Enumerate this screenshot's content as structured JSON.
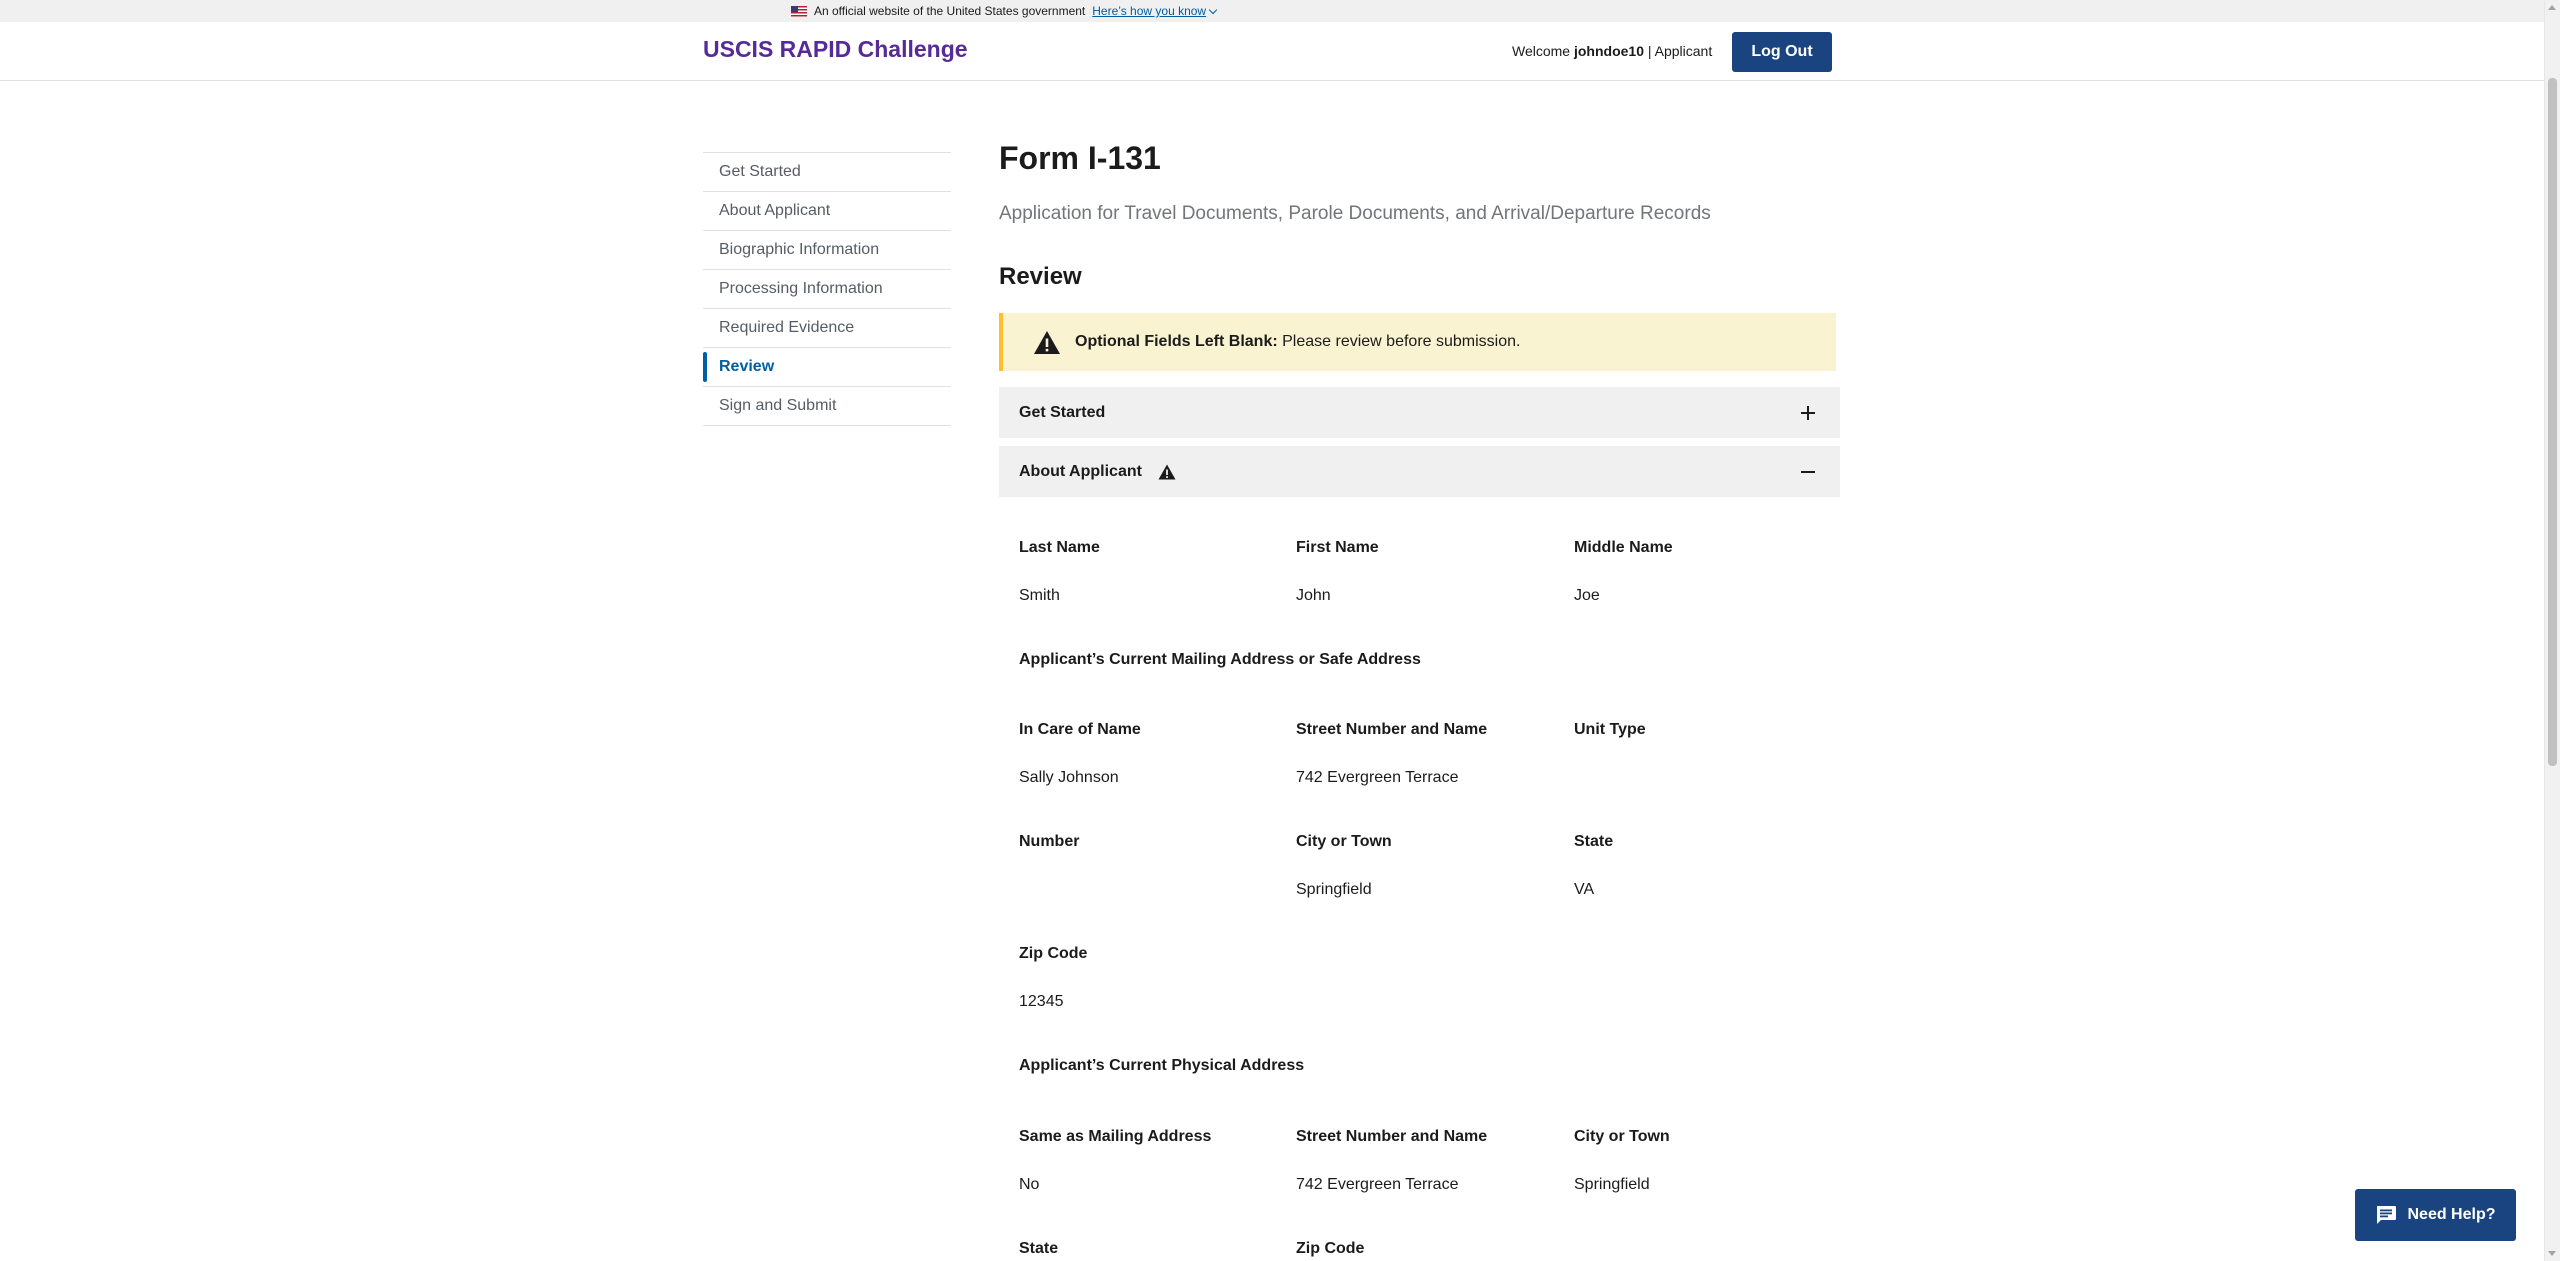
{
  "gov_banner": {
    "text": "An official website of the United States government",
    "link": "Here’s how you know"
  },
  "header": {
    "site_title": "USCIS RAPID Challenge",
    "welcome_prefix": "Welcome ",
    "username": "johndoe10",
    "role": " | Applicant",
    "logout_label": "Log Out"
  },
  "sidenav": {
    "items": [
      {
        "label": "Get Started"
      },
      {
        "label": "About Applicant"
      },
      {
        "label": "Biographic Information"
      },
      {
        "label": "Processing Information"
      },
      {
        "label": "Required Evidence"
      },
      {
        "label": "Review",
        "active": true
      },
      {
        "label": "Sign and Submit"
      }
    ]
  },
  "main": {
    "form_title": "Form I-131",
    "form_subtitle": "Application for Travel Documents, Parole Documents, and Arrival/Departure Records",
    "section_title": "Review",
    "alert": {
      "bold": "Optional Fields Left Blank:",
      "text": " Please review before submission."
    },
    "accordions": [
      {
        "label": "Get Started",
        "expanded": false
      },
      {
        "label": "About Applicant",
        "expanded": true,
        "has_warning": true
      }
    ]
  },
  "about_applicant": {
    "last_name_label": "Last Name",
    "last_name": "Smith",
    "first_name_label": "First Name",
    "first_name": "John",
    "middle_name_label": "Middle Name",
    "middle_name": "Joe",
    "mailing_heading": "Applicant’s Current Mailing Address or Safe Address",
    "in_care_of_label": "In Care of Name",
    "in_care_of": "Sally Johnson",
    "street_label": "Street Number and Name",
    "street": "742 Evergreen Terrace",
    "unit_type_label": "Unit Type",
    "unit_type": "",
    "number_label": "Number",
    "number": "",
    "city_label": "City or Town",
    "city": "Springfield",
    "state_label": "State",
    "state": "VA",
    "zip_label": "Zip Code",
    "zip": "12345",
    "physical_heading": "Applicant’s Current Physical Address",
    "same_as_mailing_label": "Same as Mailing Address",
    "same_as_mailing": "No",
    "phys_street_label": "Street Number and Name",
    "phys_street": "742 Evergreen Terrace",
    "phys_city_label": "City or Town",
    "phys_city": "Springfield",
    "phys_state_label": "State",
    "phys_zip_label": "Zip Code"
  },
  "help": {
    "label": "Need Help?"
  },
  "colors": {
    "brand_purple": "#562b97",
    "primary_blue": "#1a4480",
    "link_blue": "#005ea2",
    "warning_yellow": "#ffbe2e",
    "warning_bg": "#faf3d1"
  },
  "icons": [
    "us-flag-icon",
    "chevron-down-icon",
    "warning-icon",
    "plus-icon",
    "minus-icon",
    "chat-icon"
  ]
}
